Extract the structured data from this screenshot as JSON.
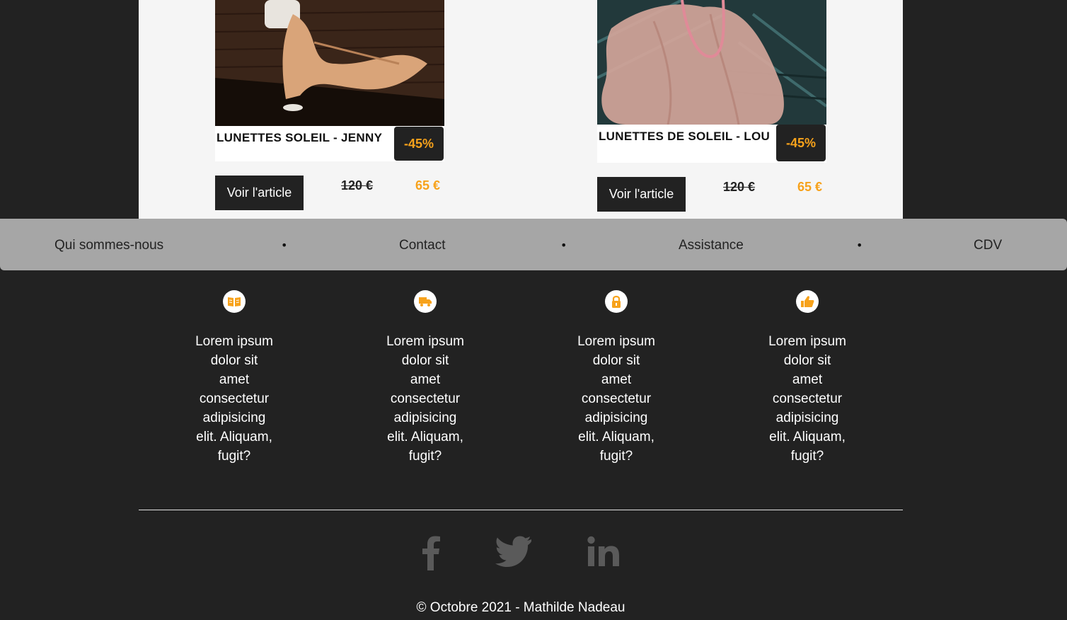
{
  "products": [
    {
      "title": "LUNETTES SOLEIL - JENNY",
      "discount": "-45%",
      "button_label": "Voir l'article",
      "old_price": "120 €",
      "new_price": "65 €"
    },
    {
      "title": "LUNETTES DE SOLEIL - LOU",
      "discount": "-45%",
      "button_label": "Voir l'article",
      "old_price": "120 €",
      "new_price": "65 €"
    }
  ],
  "nav": {
    "links": [
      "Qui sommes-nous",
      "Contact",
      "Assistance",
      "CDV"
    ],
    "separator": "•"
  },
  "features": [
    {
      "icon": "book-icon",
      "text": "Lorem ipsum dolor sit amet consectetur adipisicing elit. Aliquam, fugit?"
    },
    {
      "icon": "truck-icon",
      "text": "Lorem ipsum dolor sit amet consectetur adipisicing elit. Aliquam, fugit?"
    },
    {
      "icon": "lock-icon",
      "text": "Lorem ipsum dolor sit amet consectetur adipisicing elit. Aliquam, fugit?"
    },
    {
      "icon": "thumbs-up-icon",
      "text": "Lorem ipsum dolor sit amet consectetur adipisicing elit. Aliquam, fugit?"
    }
  ],
  "social": [
    "facebook-icon",
    "twitter-icon",
    "linkedin-icon"
  ],
  "footer": {
    "copyright": "© Octobre 2021 - Mathilde Nadeau"
  },
  "colors": {
    "accent": "#f7a21b",
    "dark": "#222222",
    "nav_bg": "#a6a6a6",
    "social_icon": "#5a5a5a"
  }
}
